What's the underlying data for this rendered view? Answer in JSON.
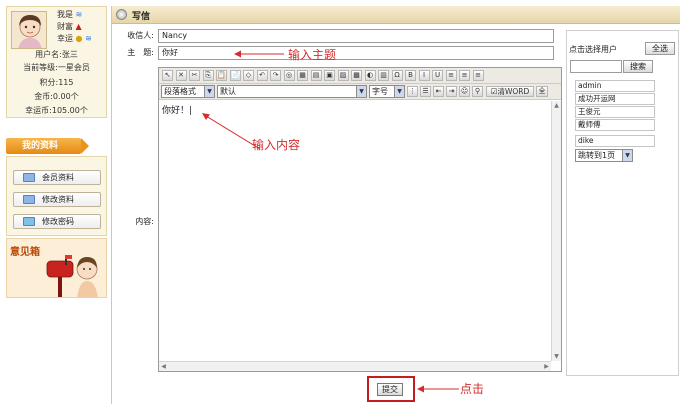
{
  "sidebar": {
    "stats": [
      {
        "label": "我是",
        "icon": "wave-icon"
      },
      {
        "label": "财富",
        "icon": "triangle-icon"
      },
      {
        "label": "幸运",
        "icon": "coin-icon"
      }
    ],
    "username": "用户名:张三",
    "level": "当前等级:一星会员",
    "points": "积分:115",
    "gold": "金币:0.00个",
    "lucky_coins": "幸运币:105.00个",
    "my_info_tab": "我的资料",
    "menu": [
      {
        "label": "会员资料",
        "icon": "member-info-icon"
      },
      {
        "label": "修改资料",
        "icon": "edit-profile-icon"
      },
      {
        "label": "修改密码",
        "icon": "change-password-icon"
      }
    ],
    "feedback_title": "意见箱"
  },
  "page": {
    "title": "写信"
  },
  "form": {
    "recipient_label": "收信人:",
    "recipient_value": "Nancy",
    "subject_label": "主　题:",
    "subject_value": "你好",
    "content_label": "内容:",
    "content_value": "你好！",
    "submit_label": "提交"
  },
  "editor": {
    "toolbar_row1_icons": [
      "select-icon",
      "delete-icon",
      "cut-icon",
      "copy-icon",
      "paste-icon",
      "paste-text-icon",
      "eraser-icon",
      "undo-icon",
      "redo-icon",
      "link-icon",
      "table-icon",
      "anchor-icon",
      "image-icon",
      "flash-icon",
      "media-icon",
      "file-icon",
      "special-char-icon",
      "code-icon",
      "bold-icon",
      "italic-icon",
      "underline-icon",
      "align-left-icon",
      "align-center-icon",
      "align-right-icon"
    ],
    "toolbar_row1_glyphs": [
      "↖",
      "✕",
      "✂",
      "⎘",
      "📋",
      "📄",
      "◇",
      "↶",
      "↷",
      "◎",
      "▦",
      "▤",
      "▣",
      "▨",
      "▩",
      "◐",
      "▥",
      "Ω",
      "B",
      "I",
      "U",
      "≡",
      "≡",
      "≡"
    ],
    "paragraph_format": "段落格式",
    "font_name": "默认",
    "font_size": "字号",
    "clean_word_label": "清WORD",
    "full_label": "全"
  },
  "userpanel": {
    "title": "点击选择用户",
    "select_all": "全选",
    "search_label": "搜索",
    "search_value": "",
    "users": [
      "admin",
      "成功开运网",
      "王俊元",
      "戴师傅",
      "dike"
    ],
    "page_jump": "跳转到1页"
  },
  "annotations": {
    "subject_hint": "输入主题",
    "content_hint": "输入内容",
    "click_hint": "点击"
  },
  "colors": {
    "annotation_red": "#d42d2d",
    "tab_orange": "#e58a13",
    "titlebar_tan": "#e6d6a8"
  }
}
